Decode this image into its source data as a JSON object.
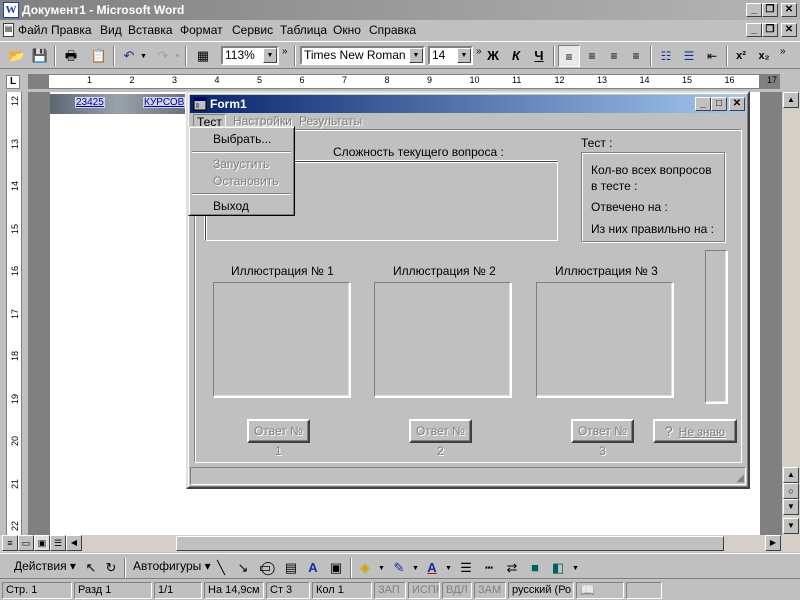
{
  "word": {
    "title": "Документ1 - Microsoft Word",
    "app_icon_letter": "W",
    "caption_buttons": {
      "minimize": "_",
      "restore": "❐",
      "close": "✕"
    },
    "menu": [
      "Файл",
      "Правка",
      "Вид",
      "Вставка",
      "Формат",
      "Сервис",
      "Таблица",
      "Окно",
      "Справка"
    ],
    "toolbar": {
      "zoom": "113%",
      "font": "Times New Roman",
      "size": "14",
      "bold": "Ж",
      "italic": "К",
      "underline": "Ч",
      "superscript": "x²",
      "subscript": "x₂"
    },
    "ruler_numbers": [
      "1",
      "2",
      "3",
      "4",
      "5",
      "6",
      "7",
      "8",
      "9",
      "10",
      "11",
      "12",
      "13",
      "14",
      "15",
      "16",
      "17"
    ],
    "vruler_numbers": [
      "12",
      "13",
      "14",
      "15",
      "16",
      "17",
      "18",
      "19",
      "20",
      "21",
      "22"
    ],
    "ruler_corner": "L",
    "doc_links": [
      "23425",
      "КУРСОВ"
    ],
    "drawbar": {
      "actions": "Действия",
      "autoshapes": "Автофигуры"
    },
    "status": {
      "page": "Стр. 1",
      "section": "Разд 1",
      "pages": "1/1",
      "at": "На 14,9см",
      "line": "Ст 3",
      "col": "Кол 1",
      "rec": "ЗАП",
      "trk": "ИСПР",
      "ext": "ВДЛ",
      "ovr": "ЗАМ",
      "lang": "русский (Ро"
    }
  },
  "form1": {
    "title": "Form1",
    "caption_buttons": {
      "minimize": "_",
      "maximize": "□",
      "close": "✕"
    },
    "menu": [
      {
        "label": "Тест",
        "enabled": true
      },
      {
        "label": "Настройки",
        "enabled": false
      },
      {
        "label": "Результаты",
        "enabled": false
      }
    ],
    "dropdown": [
      {
        "label": "Выбрать...",
        "enabled": true
      },
      {
        "label": "Запустить",
        "enabled": false
      },
      {
        "label": "Остановить",
        "enabled": false
      },
      {
        "label": "Выход",
        "enabled": true
      }
    ],
    "difficulty_label": "Сложность текущего вопроса :",
    "test_label": "Тест :",
    "stats": {
      "total_1": "Кол-во всех вопросов",
      "total_2": "в тесте :",
      "answered": "Отвечено на :",
      "correct": "Из них правильно на :"
    },
    "illustrations": [
      "Иллюстрация № 1",
      "Иллюстрация № 2",
      "Иллюстрация № 3"
    ],
    "answers": [
      "Ответ № 1",
      "Ответ № 2",
      "Ответ № 3"
    ],
    "dont_know": "Не знаю",
    "dont_know_icon": "?"
  }
}
